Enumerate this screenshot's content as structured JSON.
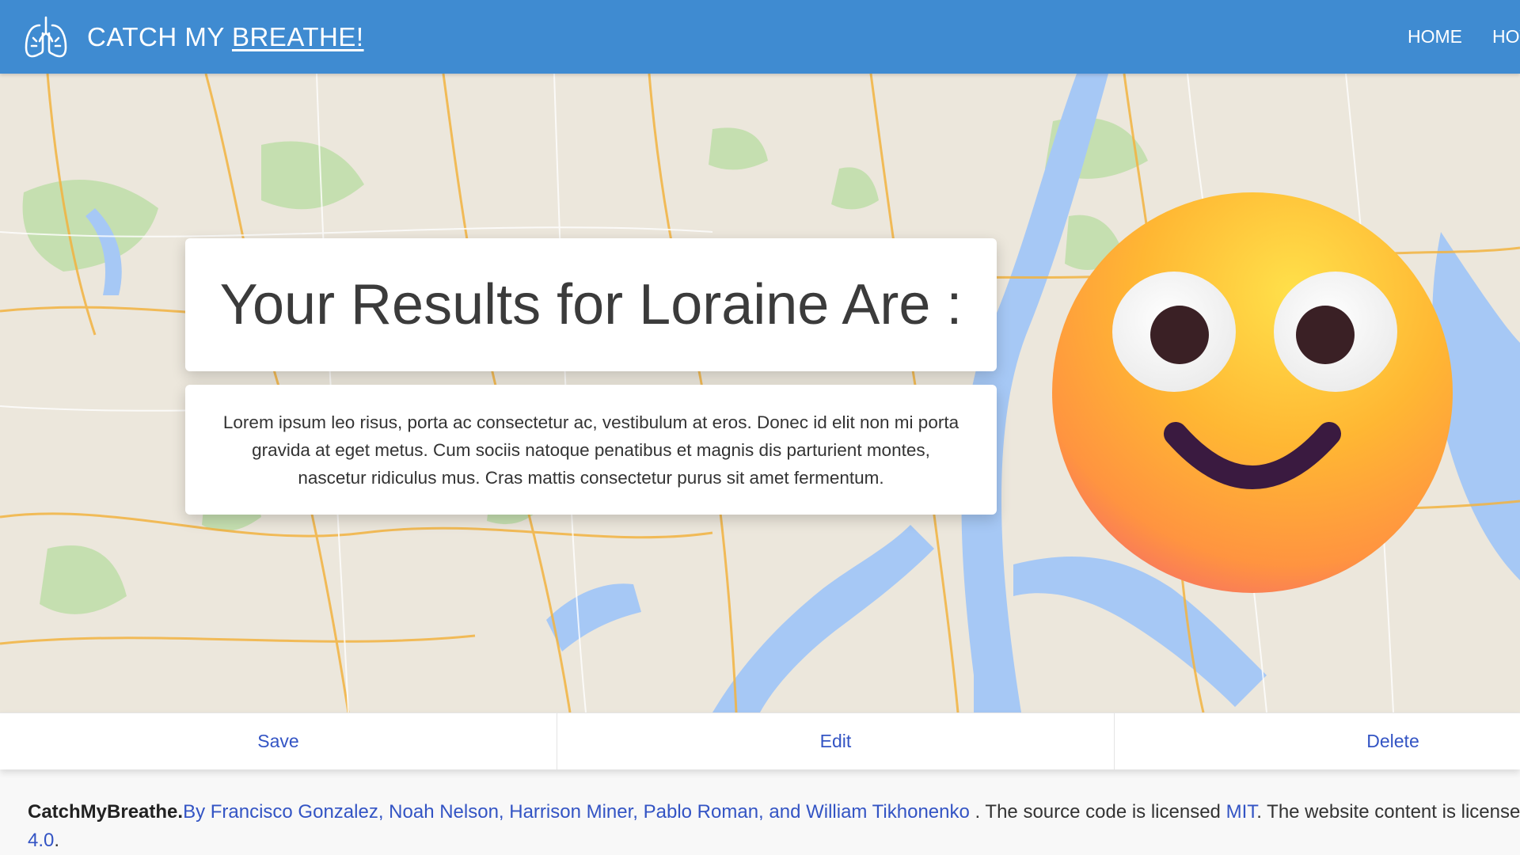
{
  "navbar": {
    "brand_prefix": "CATCH MY",
    "brand_underlined": "BREATHE!",
    "logo_icon": "lungs-icon",
    "links": [
      "HOME",
      "HOW"
    ]
  },
  "hero": {
    "background": "map",
    "title": "Your Results for Loraine Are :",
    "description": "Lorem ipsum leo risus, porta ac consectetur ac, vestibulum at eros. Donec id elit non mi porta gravida at eget metus. Cum sociis natoque penatibus et magnis dis parturient montes, nascetur ridiculus mus. Cras mattis consectetur purus sit amet fermentum.",
    "result_icon": "smiling-face-emoji"
  },
  "actions": {
    "save": "Save",
    "edit": "Edit",
    "delete": "Delete"
  },
  "footer": {
    "site_name": "CatchMyBreathe.",
    "authors": "By Francisco Gonzalez, Noah Nelson, Harrison Miner, Pablo Roman, and William Tikhonenko",
    "license_prefix": " . The source code is licensed ",
    "license_code": "MIT",
    "license_suffix": ". The website content is licensed",
    "license_version": "4.0",
    "end": "."
  },
  "colors": {
    "navbar": "#3f8bd1",
    "link": "#3354c4",
    "water": "#a6c8f5",
    "land": "#ece7dc",
    "road": "#f2b340"
  }
}
